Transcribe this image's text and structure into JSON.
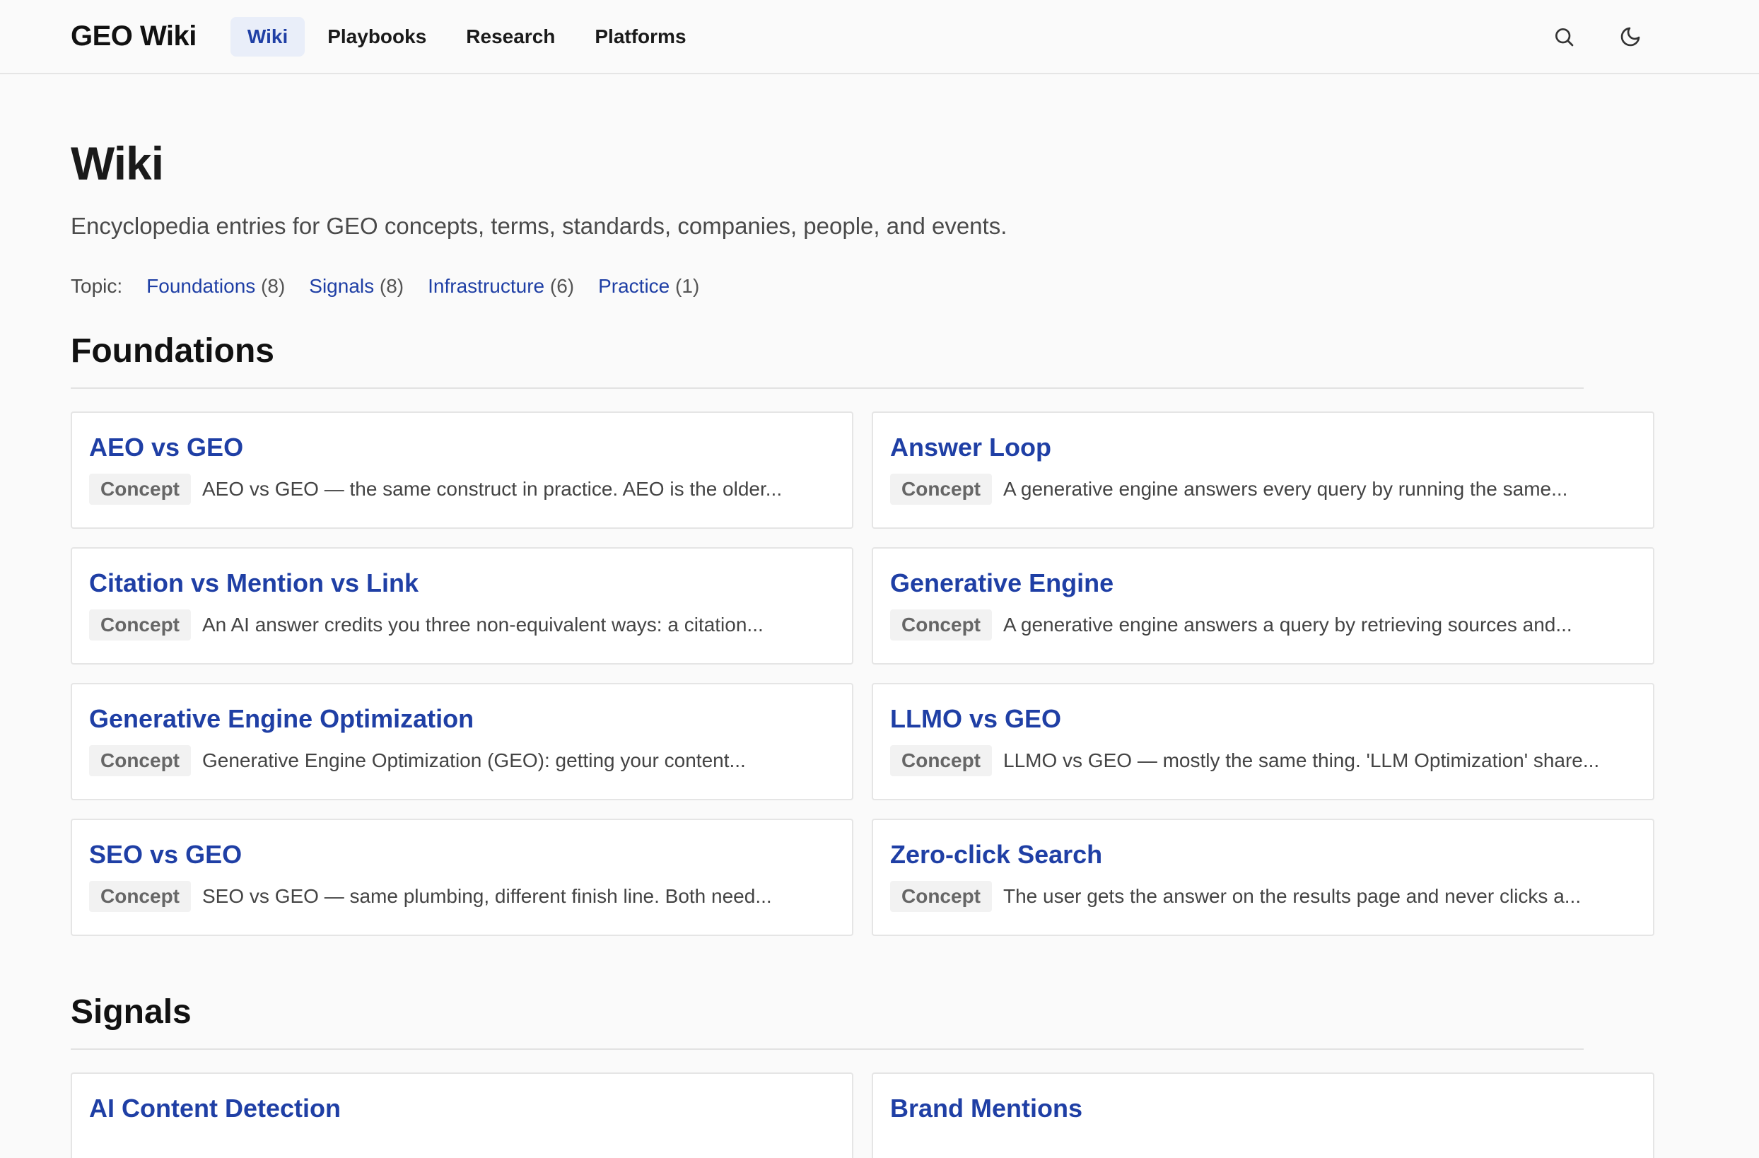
{
  "header": {
    "logo": "GEO Wiki",
    "nav": [
      {
        "label": "Wiki",
        "active": true
      },
      {
        "label": "Playbooks"
      },
      {
        "label": "Research"
      },
      {
        "label": "Platforms"
      }
    ],
    "icons": [
      "search-icon",
      "moon-icon"
    ]
  },
  "page": {
    "title": "Wiki",
    "subtitle": "Encyclopedia entries for GEO concepts, terms, standards, companies, people, and events.",
    "topic_label": "Topic:",
    "topics": [
      {
        "name": "Foundations",
        "count": "(8)"
      },
      {
        "name": "Signals",
        "count": "(8)"
      },
      {
        "name": "Infrastructure",
        "count": "(6)"
      },
      {
        "name": "Practice",
        "count": "(1)"
      }
    ]
  },
  "sections": [
    {
      "title": "Foundations",
      "cards": [
        {
          "title": "AEO vs GEO",
          "badge": "Concept",
          "desc": "AEO vs GEO — the same construct in practice. AEO is the older..."
        },
        {
          "title": "Answer Loop",
          "badge": "Concept",
          "desc": "A generative engine answers every query by running the same..."
        },
        {
          "title": "Citation vs Mention vs Link",
          "badge": "Concept",
          "desc": "An AI answer credits you three non-equivalent ways: a citation..."
        },
        {
          "title": "Generative Engine",
          "badge": "Concept",
          "desc": "A generative engine answers a query by retrieving sources and..."
        },
        {
          "title": "Generative Engine Optimization",
          "badge": "Concept",
          "desc": "Generative Engine Optimization (GEO): getting your content..."
        },
        {
          "title": "LLMO vs GEO",
          "badge": "Concept",
          "desc": "LLMO vs GEO — mostly the same thing. 'LLM Optimization' share..."
        },
        {
          "title": "SEO vs GEO",
          "badge": "Concept",
          "desc": "SEO vs GEO — same plumbing, different finish line. Both need..."
        },
        {
          "title": "Zero-click Search",
          "badge": "Concept",
          "desc": "The user gets the answer on the results page and never clicks a..."
        }
      ]
    },
    {
      "title": "Signals",
      "cards": [
        {
          "title": "AI Content Detection"
        },
        {
          "title": "Brand Mentions"
        }
      ]
    }
  ]
}
